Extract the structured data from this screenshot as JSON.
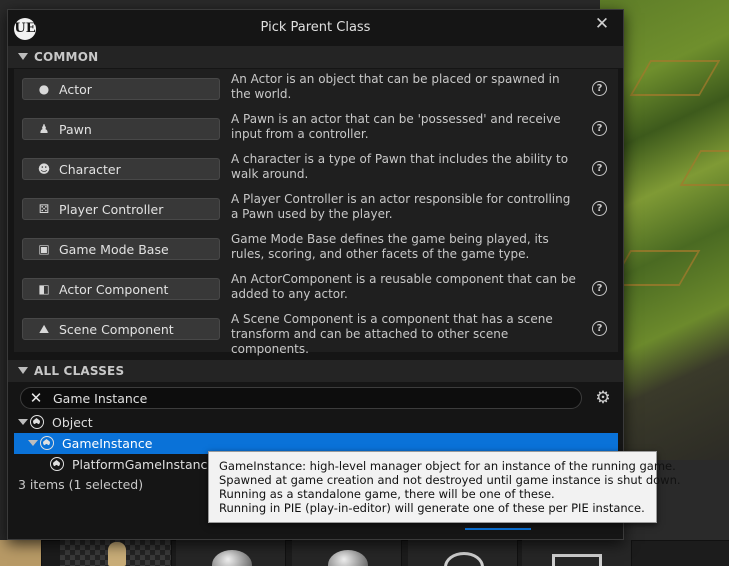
{
  "dialog": {
    "title": "Pick Parent Class",
    "logo": "UE",
    "close_icon": "close-icon",
    "close_glyph": "✕"
  },
  "common": {
    "header": "COMMON",
    "classes": [
      {
        "label": "Actor",
        "icon": "actor-icon",
        "glyph": "●",
        "description": "An Actor is an object that can be placed or spawned in the world.",
        "help": true
      },
      {
        "label": "Pawn",
        "icon": "pawn-icon",
        "glyph": "♟",
        "description": "A Pawn is an actor that can be 'possessed' and receive input from a controller.",
        "help": true
      },
      {
        "label": "Character",
        "icon": "character-icon",
        "glyph": "☻",
        "description": "A character is a type of Pawn that includes the ability to walk around.",
        "help": true
      },
      {
        "label": "Player Controller",
        "icon": "gamepad-icon",
        "glyph": "⚄",
        "description": "A Player Controller is an actor responsible for controlling a Pawn used by the player.",
        "help": true
      },
      {
        "label": "Game Mode Base",
        "icon": "game-mode-icon",
        "glyph": "▣",
        "description": "Game Mode Base defines the game being played, its rules, scoring, and other facets of the game type.",
        "help": false
      },
      {
        "label": "Actor Component",
        "icon": "actor-component-icon",
        "glyph": "◧",
        "description": "An ActorComponent is a reusable component that can be added to any actor.",
        "help": true
      },
      {
        "label": "Scene Component",
        "icon": "scene-component-icon",
        "glyph": "⛰",
        "description": "A Scene Component is a component that has a scene transform and can be attached to other scene components.",
        "help": true
      }
    ],
    "help_glyph": "?"
  },
  "all_classes": {
    "header": "ALL CLASSES",
    "search": {
      "value": "Game Instance",
      "placeholder": "Search",
      "clear_glyph": "✕"
    },
    "settings_icon": "gear-icon",
    "settings_glyph": "⚙",
    "tree": [
      {
        "label": "Object",
        "depth": 0,
        "expanded": true,
        "selected": false
      },
      {
        "label": "GameInstance",
        "depth": 1,
        "expanded": true,
        "selected": true
      },
      {
        "label": "PlatformGameInstance",
        "depth": 2,
        "expanded": false,
        "selected": false
      }
    ],
    "status": "3 items (1 selected)"
  },
  "tooltip": {
    "lines": [
      "GameInstance: high-level manager object for an instance of the running game.",
      "Spawned at game creation and not destroyed until game instance is shut down.",
      "Running as a standalone game, there will be one of these.",
      "Running in PIE (play-in-editor) will generate one of these per PIE instance."
    ]
  },
  "colors": {
    "selection": "#0a72d8",
    "panel": "#1f1f1f",
    "button": "#383838"
  }
}
